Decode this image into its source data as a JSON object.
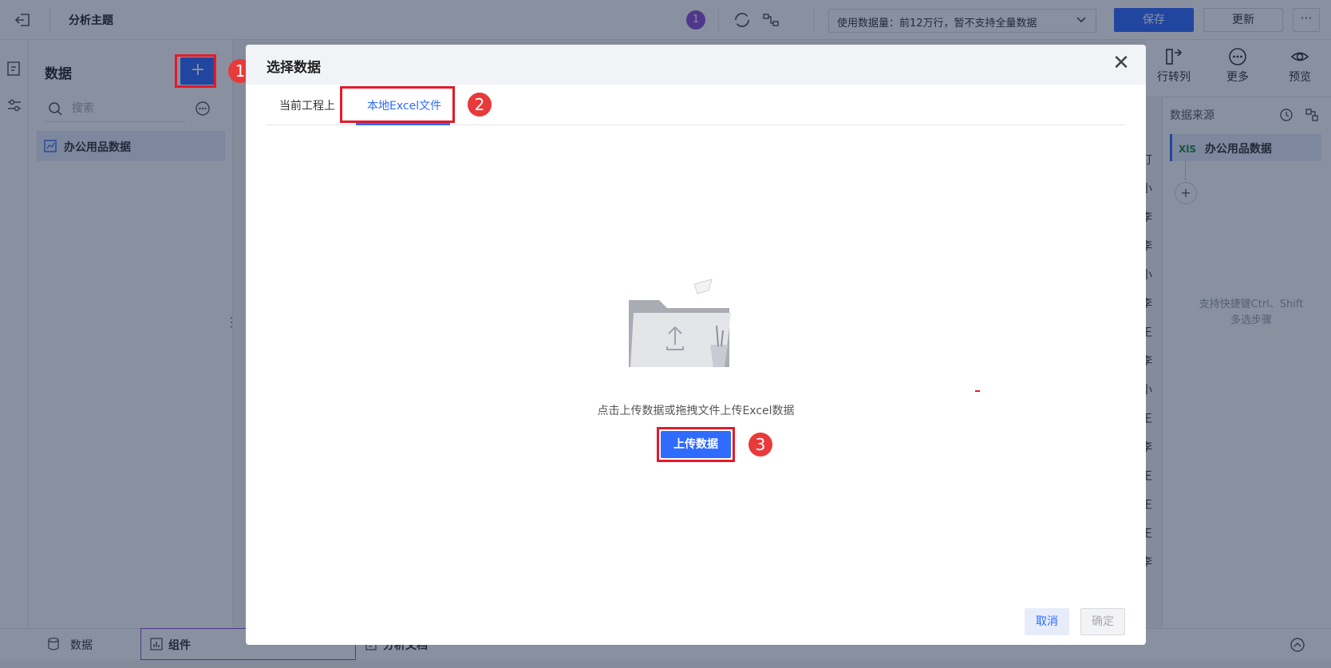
{
  "topbar": {
    "title": "分析主题",
    "badge_count": "1",
    "usage_text": "使用数据量：前12万行，暂不支持全量数据",
    "save_label": "保存",
    "update_label": "更新",
    "more_label": "···"
  },
  "left_panel": {
    "title": "数据",
    "add_label": "+",
    "search_placeholder": "搜索",
    "items": [
      {
        "label": "办公用品数据"
      }
    ]
  },
  "right_tools": [
    {
      "label": "行转列",
      "icon": "row-to-column-icon"
    },
    {
      "label": "更多",
      "icon": "more-circle-icon"
    },
    {
      "label": "预览",
      "icon": "eye-icon"
    }
  ],
  "right_panel": {
    "title": "数据来源",
    "source_item": "办公用品数据",
    "source_icon": "XlS",
    "add_label": "+",
    "hint_line1": "支持快捷键Ctrl、Shift",
    "hint_line2": "多选步骤"
  },
  "mid_strip_chars": [
    "订",
    "小",
    "李",
    "李",
    "小",
    "李",
    "王",
    "李",
    "小",
    "王",
    "李",
    "王",
    "王",
    "王",
    "李"
  ],
  "bottom_tabs": {
    "data": "数据",
    "component": "组件",
    "doc": "分析文档"
  },
  "modal": {
    "title": "选择数据",
    "close_label": "✕",
    "tabs": [
      {
        "label": "当前工程上"
      },
      {
        "label": "本地Excel文件"
      }
    ],
    "upload_hint": "点击上传数据或拖拽文件上传Excel数据",
    "upload_button": "上传数据",
    "cancel_button": "取消",
    "ok_button": "确定"
  },
  "annotations": [
    "1",
    "2",
    "3"
  ],
  "colors": {
    "accent": "#2f6bff",
    "highlight_box": "#e4192b",
    "step_circle": "#e83a3a",
    "badge": "#8a4fd6"
  }
}
